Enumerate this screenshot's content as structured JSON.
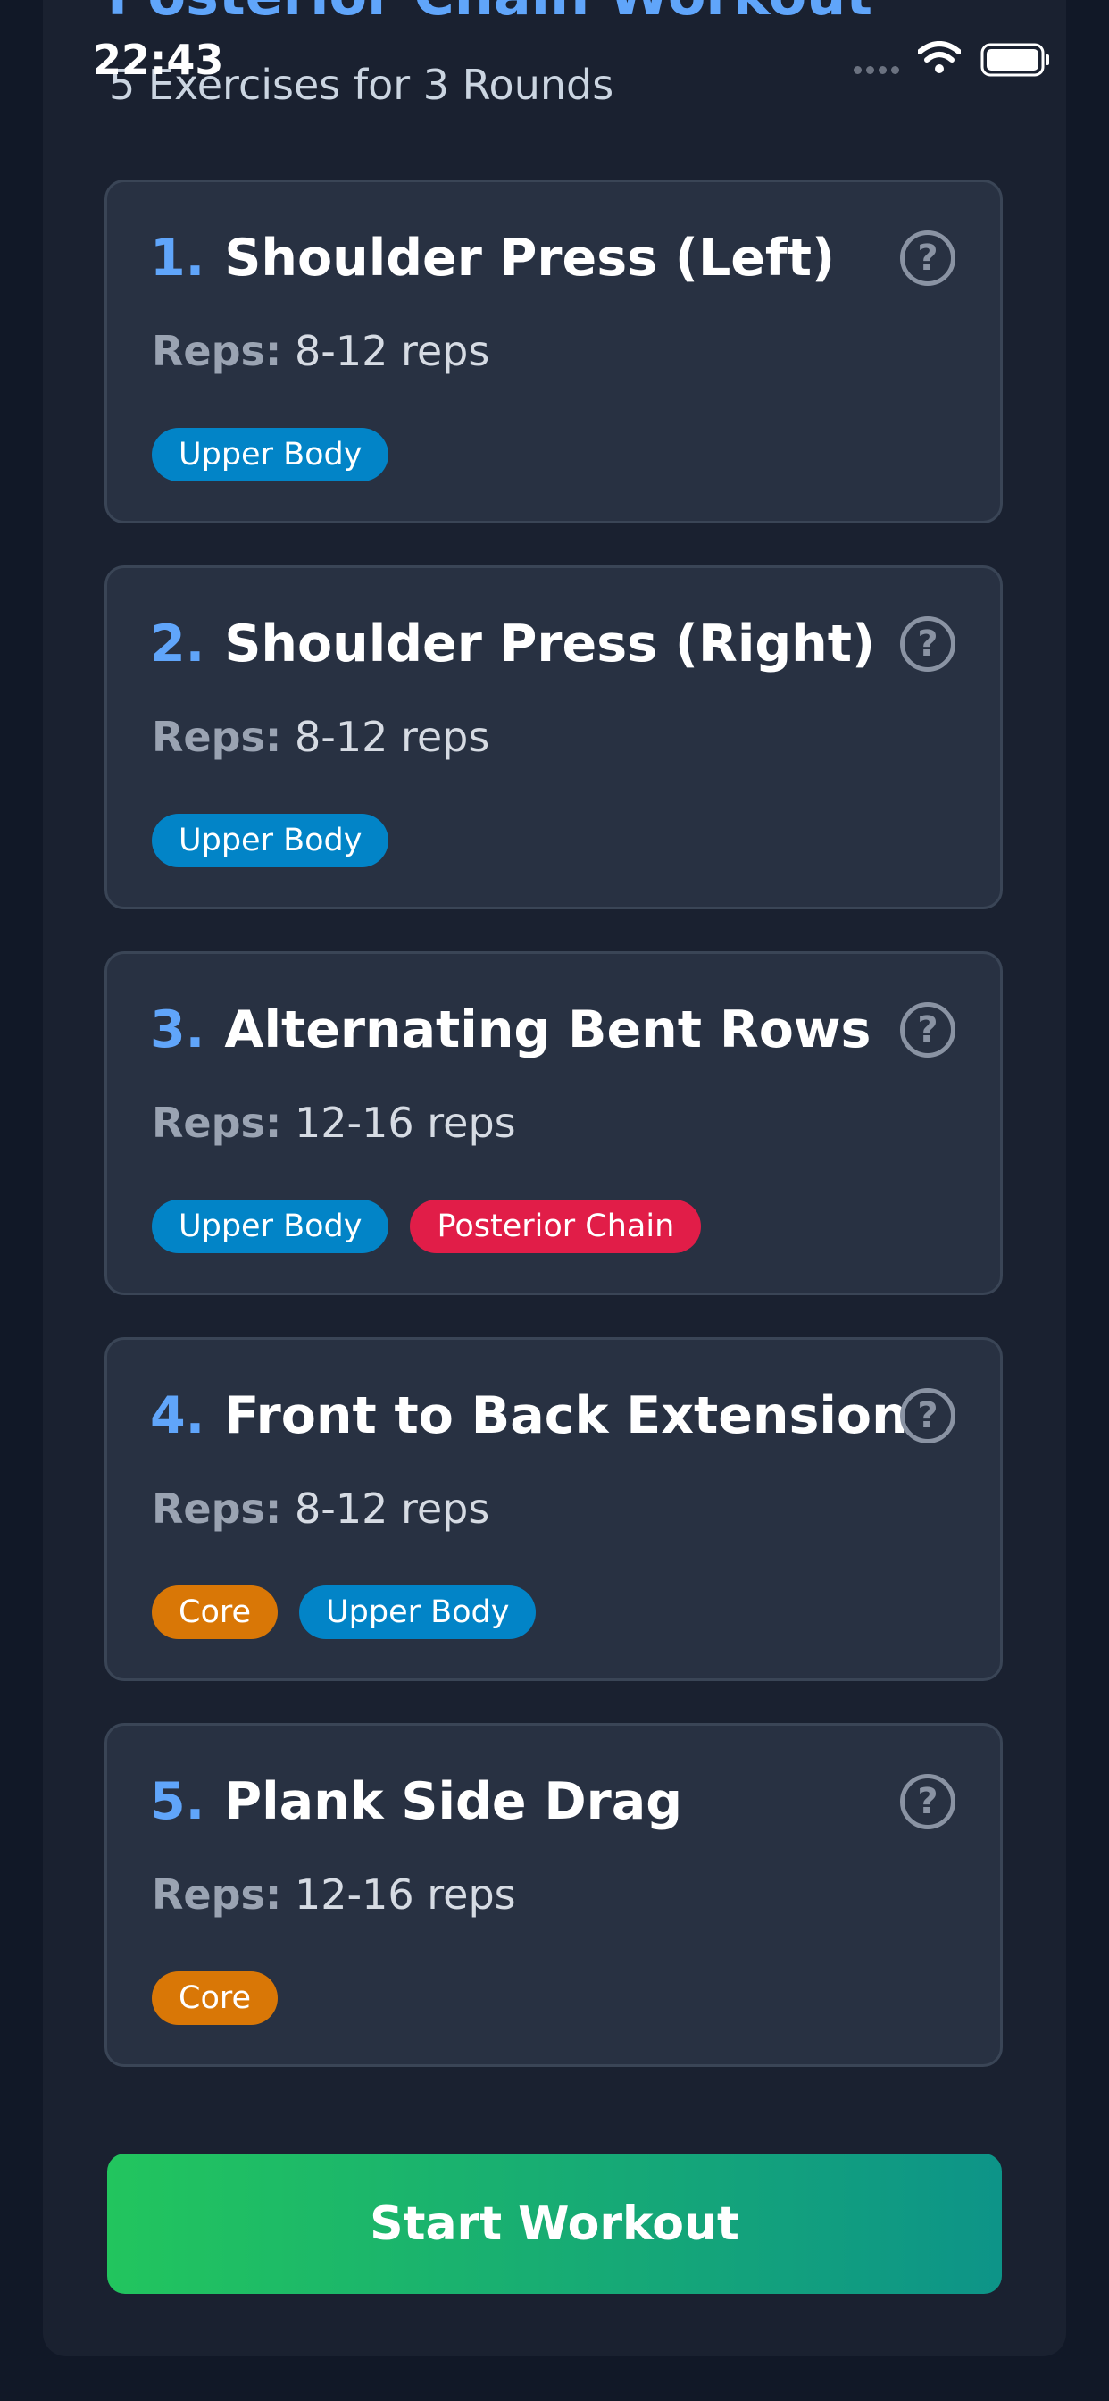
{
  "status_bar": {
    "time": "22:43"
  },
  "header": {
    "title": "Posterior Chain Workout",
    "subtitle": "5 Exercises for 3 Rounds"
  },
  "reps_label": "Reps:",
  "tag_colors": {
    "Upper Body": "#0284c7",
    "Posterior Chain": "#e11d48",
    "Core": "#d97706"
  },
  "exercises": [
    {
      "number": "1.",
      "name": "Shoulder Press (Left)",
      "reps": "8-12 reps",
      "tags": [
        "Upper Body"
      ]
    },
    {
      "number": "2.",
      "name": "Shoulder Press (Right)",
      "reps": "8-12 reps",
      "tags": [
        "Upper Body"
      ]
    },
    {
      "number": "3.",
      "name": "Alternating Bent Rows",
      "reps": "12-16 reps",
      "tags": [
        "Upper Body",
        "Posterior Chain"
      ]
    },
    {
      "number": "4.",
      "name": "Front to Back Extension",
      "reps": "8-12 reps",
      "tags": [
        "Core",
        "Upper Body"
      ]
    },
    {
      "number": "5.",
      "name": "Plank Side Drag",
      "reps": "12-16 reps",
      "tags": [
        "Core"
      ]
    }
  ],
  "icons": {
    "help": "question-circle-icon",
    "signal": "cellular-signal-icon",
    "wifi": "wifi-icon",
    "battery": "battery-icon"
  },
  "start_button": {
    "label": "Start Workout"
  }
}
